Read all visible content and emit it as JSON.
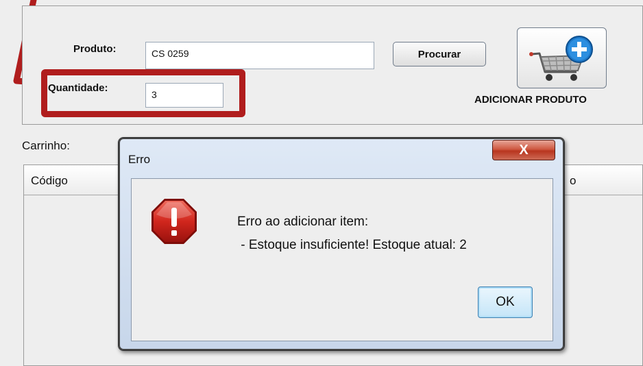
{
  "form": {
    "product_label": "Produto:",
    "product_value": "CS 0259",
    "quantity_label": "Quantidade:",
    "quantity_value": "3",
    "search_button": "Procurar",
    "add_product_label": "ADICIONAR PRODUTO"
  },
  "cart": {
    "label": "Carrinho:",
    "columns": [
      "Código",
      "o"
    ]
  },
  "dialog": {
    "title": "Erro",
    "close_label": "X",
    "message_line1": "Erro ao adicionar item:",
    "message_line2": " - Estoque insuficiente! Estoque atual: 2",
    "ok_button": "OK"
  },
  "colors": {
    "annotation_red": "#b01d1d",
    "dialog_frame": "#c7d6ea",
    "close_red": "#c0432c",
    "error_icon_red": "#c8201a"
  },
  "icons": {
    "add_product": "cart-plus-icon",
    "error": "error-stop-icon"
  }
}
